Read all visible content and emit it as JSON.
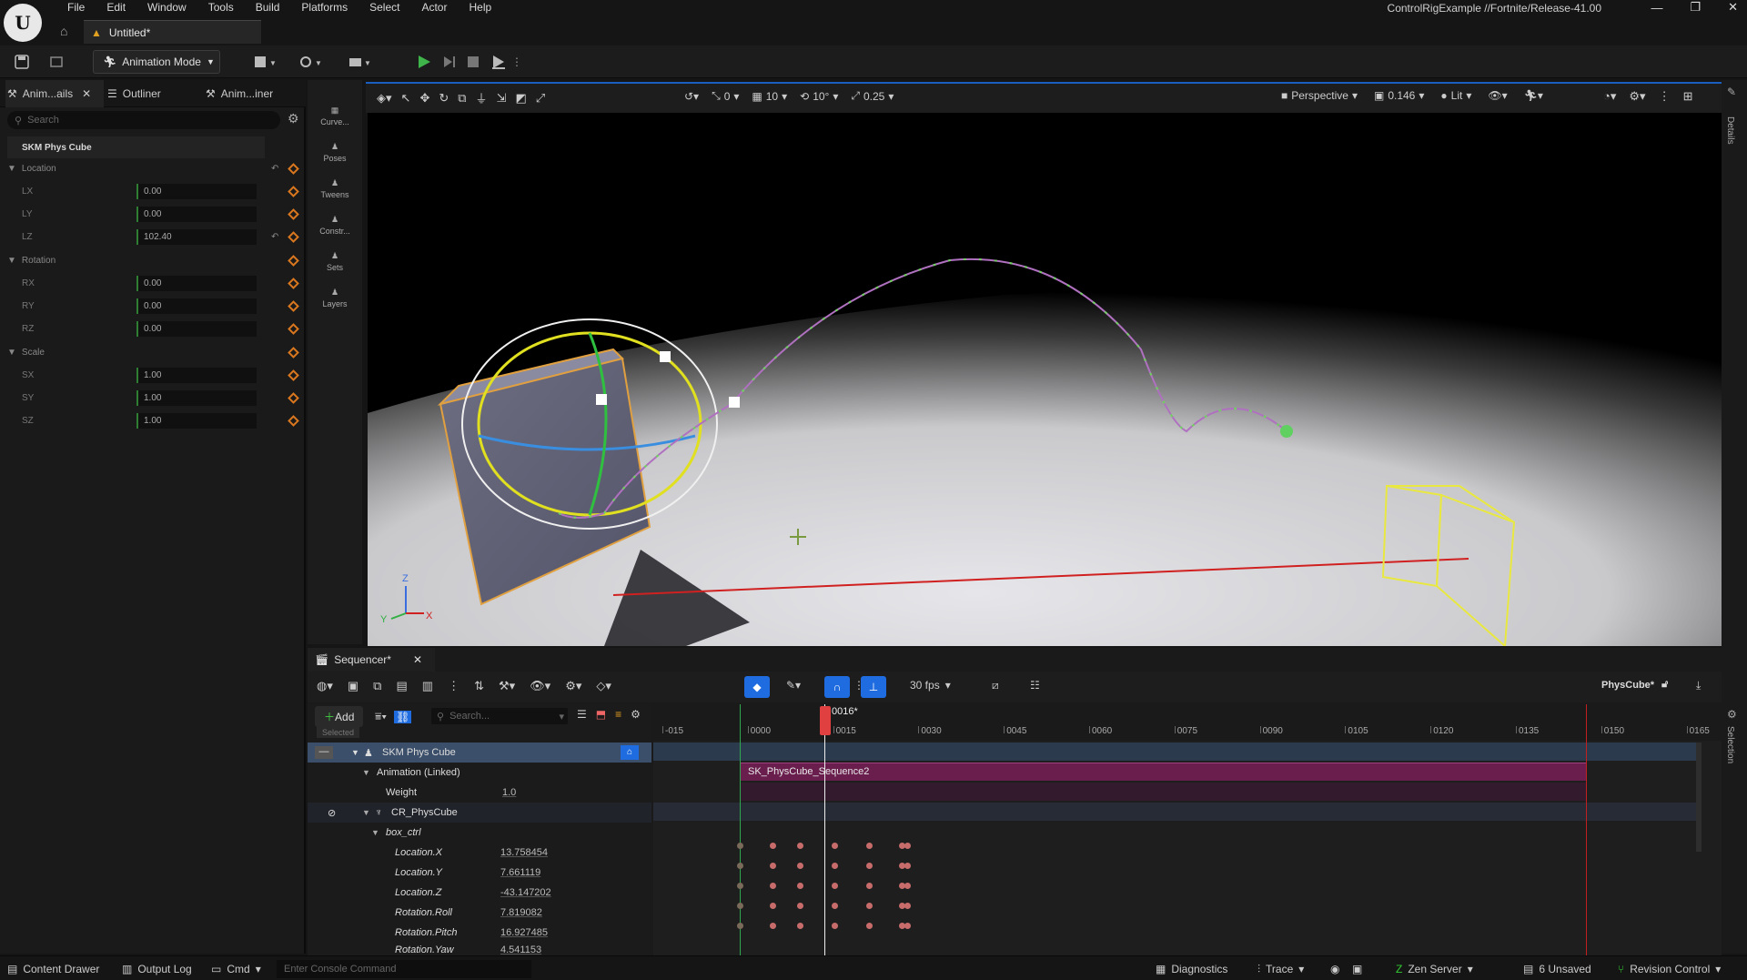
{
  "app": {
    "menus": [
      "File",
      "Edit",
      "Window",
      "Tools",
      "Build",
      "Platforms",
      "Select",
      "Actor",
      "Help"
    ],
    "project": "ControlRigExample //Fortnite/Release-41.00",
    "tab_title": "Untitled*"
  },
  "toolbar": {
    "mode_label": "Animation Mode"
  },
  "left_panel": {
    "tabs": [
      "Anim...ails",
      "Outliner",
      "Anim...iner"
    ],
    "search_placeholder": "Search",
    "object_name": "SKM Phys Cube",
    "categories": {
      "location": "Location",
      "rotation": "Rotation",
      "scale": "Scale"
    },
    "location": [
      {
        "label": "LX",
        "value": "0.00"
      },
      {
        "label": "LY",
        "value": "0.00"
      },
      {
        "label": "LZ",
        "value": "102.40"
      }
    ],
    "rotation": [
      {
        "label": "RX",
        "value": "0.00"
      },
      {
        "label": "RY",
        "value": "0.00"
      },
      {
        "label": "RZ",
        "value": "0.00"
      }
    ],
    "scale": [
      {
        "label": "SX",
        "value": "1.00"
      },
      {
        "label": "SY",
        "value": "1.00"
      },
      {
        "label": "SZ",
        "value": "1.00"
      }
    ]
  },
  "tool_strip": [
    "Curve...",
    "Poses",
    "Tweens",
    "Constr...",
    "Sets",
    "Layers"
  ],
  "viewport_toolbar": {
    "translate_snap": "0",
    "grid_snap": "10",
    "rotate_snap": "10°",
    "scale_snap": "0.25",
    "view_mode": "Perspective",
    "camera_speed": "0.146",
    "lighting": "Lit"
  },
  "right_strip": {
    "details": "Details",
    "selection": "Selection"
  },
  "sequencer": {
    "tab": "Sequencer*",
    "fps": "30 fps",
    "asset_name": "PhysCube*",
    "add_label": "Add",
    "search_placeholder": "Search...",
    "selected_label": "Selected",
    "current_frame": "0016*",
    "ticks": [
      "-015",
      "0000",
      "0015",
      "0030",
      "0045",
      "0060",
      "0075",
      "0090",
      "0105",
      "0120",
      "0135",
      "0150",
      "0165"
    ],
    "section_label": "SK_PhysCube_Sequence2",
    "tracks": [
      {
        "name": "SKM Phys Cube",
        "value": ""
      },
      {
        "name": "Animation (Linked)",
        "value": ""
      },
      {
        "name": "Weight",
        "value": "1.0"
      },
      {
        "name": "CR_PhysCube",
        "value": ""
      },
      {
        "name": "box_ctrl",
        "value": ""
      },
      {
        "name": "Location.X",
        "value": "13.758454"
      },
      {
        "name": "Location.Y",
        "value": "7.661119"
      },
      {
        "name": "Location.Z",
        "value": "-43.147202"
      },
      {
        "name": "Rotation.Roll",
        "value": "7.819082"
      },
      {
        "name": "Rotation.Pitch",
        "value": "16.927485"
      },
      {
        "name": "Rotation.Yaw",
        "value": "4.541153"
      }
    ]
  },
  "axis_labels": {
    "z": "Z",
    "y": "Y",
    "x": "X"
  },
  "statusbar": {
    "content_drawer": "Content Drawer",
    "output_log": "Output Log",
    "cmd": "Cmd",
    "console_placeholder": "Enter Console Command",
    "diagnostics": "Diagnostics",
    "trace": "Trace",
    "zen_server": "Zen Server",
    "unsaved": "6 Unsaved",
    "revision_control": "Revision Control"
  }
}
